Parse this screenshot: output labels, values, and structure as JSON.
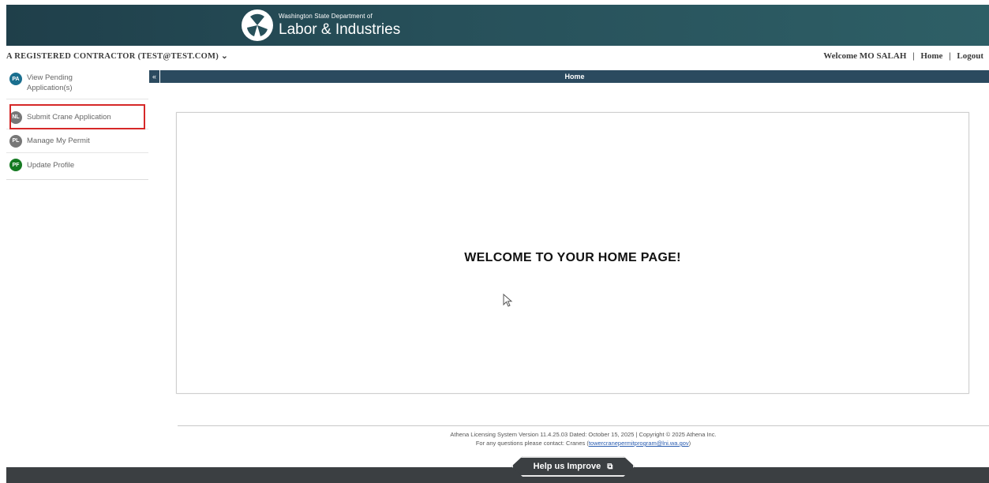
{
  "header": {
    "org_small": "Washington State Department of",
    "org_big": "Labor & Industries"
  },
  "account": {
    "name": "A REGISTERED CONTRACTOR  (TEST@TEST.COM)",
    "chevron": "⌄",
    "welcome": "Welcome MO SALAH",
    "home_link": "Home",
    "logout_link": "Logout",
    "separator": "|"
  },
  "sidebar": {
    "collapse_icon": "«",
    "items": [
      {
        "badge": "PA",
        "label": "View Pending Application(s)",
        "color": "#1a6f8f"
      },
      {
        "badge": "NL",
        "label": "Submit Crane Application",
        "color": "#777777"
      },
      {
        "badge": "PL",
        "label": "Manage My Permit",
        "color": "#777777"
      },
      {
        "badge": "PF",
        "label": "Update Profile",
        "color": "#157a22"
      }
    ]
  },
  "main": {
    "bar_title": "Home",
    "welcome_text": "WELCOME TO YOUR HOME PAGE!"
  },
  "footer": {
    "line1": "Athena Licensing System Version 11.4.25.03 Dated: October 15, 2025 | Copyright © 2025 Athena Inc.",
    "line2_prefix": "For any questions please contact: Cranes (",
    "email": "towercranepermitprogram@lni.wa.gov",
    "line2_suffix": ")",
    "help_button": "Help us Improve",
    "help_icon": "external-link-icon"
  },
  "colors": {
    "banner": "#27505a",
    "navbar": "#2b4a5f",
    "highlight": "#d62828"
  }
}
